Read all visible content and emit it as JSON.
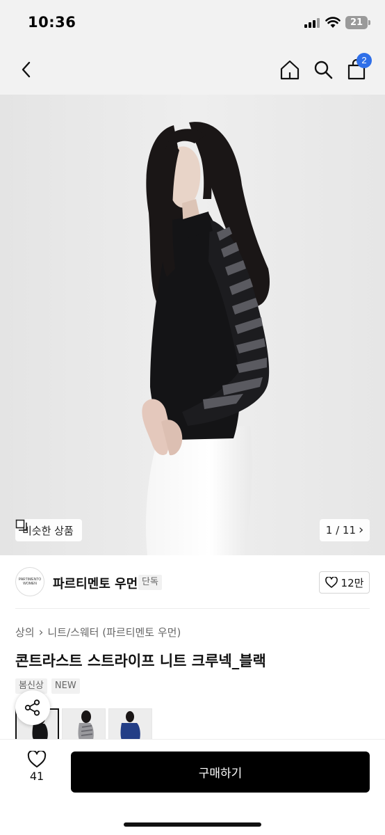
{
  "status_bar": {
    "time": "10:36",
    "battery": "21"
  },
  "nav": {
    "cart_count": "2",
    "icons": [
      "chevron-left-icon",
      "home-icon",
      "search-icon",
      "cart-icon"
    ]
  },
  "hero": {
    "similar_label": "비슷한 상품",
    "page_indicator": "1 / 11",
    "arrow": "›"
  },
  "brand": {
    "logo_line1": "PARTIMENTO",
    "logo_line2": "WOMEN",
    "name": "파르티멘토 우먼",
    "exclusive": "단독",
    "likes": "12만"
  },
  "breadcrumb": {
    "category": "상의",
    "separator": "›",
    "subcategory": "니트/스웨터 (파르티멘토 우먼)"
  },
  "product": {
    "title": "콘트라스트 스트라이프 니트 크루넥_블랙",
    "tags": [
      "봄신상",
      "NEW"
    ]
  },
  "colors": {
    "accent": "#2f6fe8",
    "button": "#000000"
  },
  "bottom": {
    "like_count": "41",
    "buy_label": "구매하기"
  }
}
